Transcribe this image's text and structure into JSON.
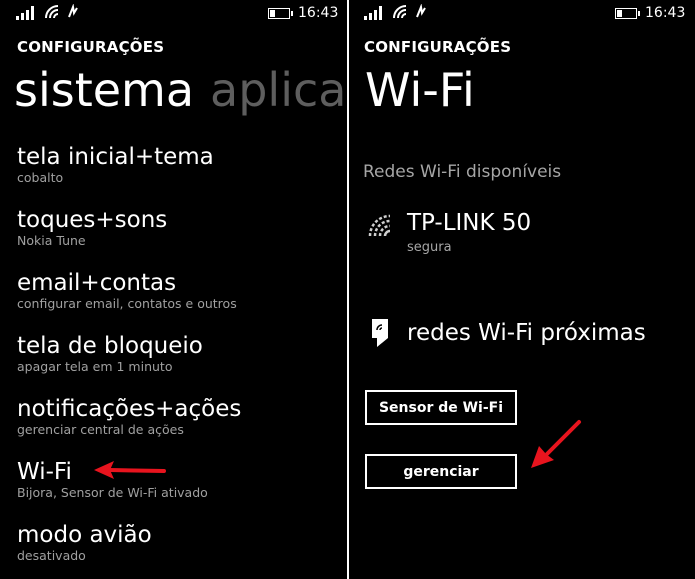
{
  "status_bar": {
    "time": "16:43"
  },
  "left": {
    "header": "CONFIGURAÇÕES",
    "pivot": {
      "active": "sistema",
      "inactive": "aplicat"
    },
    "items": [
      {
        "label": "tela inicial+tema",
        "sub": "cobalto"
      },
      {
        "label": "toques+sons",
        "sub": "Nokia Tune"
      },
      {
        "label": "email+contas",
        "sub": "configurar email, contatos e outros"
      },
      {
        "label": "tela de bloqueio",
        "sub": "apagar tela em 1 minuto"
      },
      {
        "label": "notificações+ações",
        "sub": "gerenciar central de ações"
      },
      {
        "label": "Wi-Fi",
        "sub": "Bijora, Sensor de Wi-Fi ativado"
      },
      {
        "label": "modo avião",
        "sub": "desativado"
      }
    ]
  },
  "right": {
    "header": "CONFIGURAÇÕES",
    "title": "Wi-Fi",
    "section_label": "Redes Wi-Fi disponíveis",
    "network": {
      "name": "TP-LINK 50",
      "status": "segura"
    },
    "nearby_label": "redes Wi-Fi próximas",
    "buttons": {
      "sensor": "Sensor de Wi-Fi",
      "manage": "gerenciar"
    }
  },
  "colors": {
    "background": "#000000",
    "text": "#ffffff",
    "subtext": "#a0a0a0",
    "pivot_inactive": "#5e5e5e",
    "annotation_arrow": "#e8141e"
  },
  "icons": [
    "signal-bars-icon",
    "wifi-icon",
    "data-sense-icon",
    "battery-icon",
    "wifi-signal-icon",
    "tag-icon",
    "red-arrow-annotation"
  ]
}
